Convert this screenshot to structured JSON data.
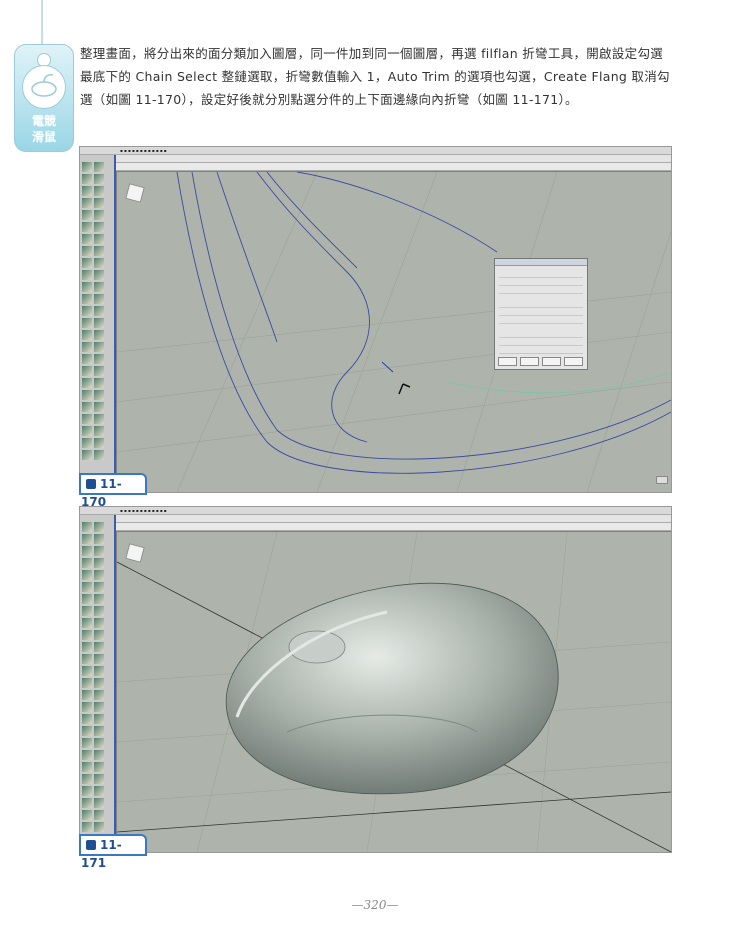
{
  "sidebar_tag": {
    "text": "電競\n滑鼠"
  },
  "paragraph": "整理畫面，將分出來的面分類加入圖層，同一件加到同一個圖層，再選 filflan 折彎工具，開啟設定勾選最底下的 Chain Select 整鏈選取，折彎數值輸入 1，Auto Trim 的選項也勾選，Create Flang 取消勾選（如圖 11-170），設定好後就分別點選分件的上下面邊緣向內折彎（如圖 11-171）。",
  "figures": [
    {
      "label": "11-170"
    },
    {
      "label": "11-171"
    }
  ],
  "page_number": "—320—",
  "colors": {
    "accent": "#3b78c4",
    "tag": "#9ad6e6"
  }
}
